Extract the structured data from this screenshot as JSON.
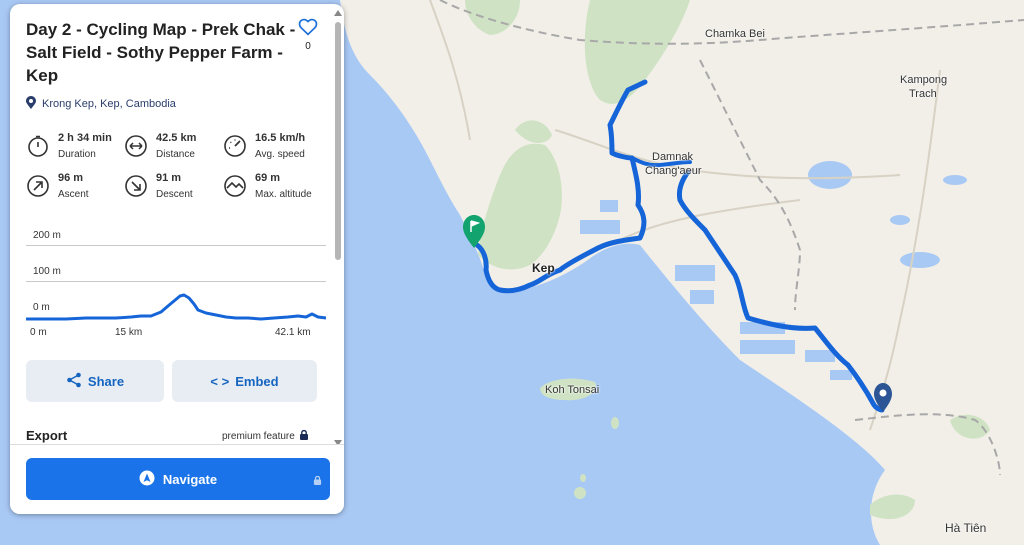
{
  "route": {
    "title": "Day 2 - Cycling Map - Prek Chak - Salt Field - Sothy Pepper Farm - Kep",
    "favorite_icon": "heart-outline-icon",
    "favorite_count": "0",
    "location": "Krong Kep, Kep, Cambodia",
    "location_icon": "location-pin-icon"
  },
  "stats": [
    {
      "icon": "stopwatch-icon",
      "value": "2 h 34 min",
      "label": "Duration"
    },
    {
      "icon": "distance-arrows-icon",
      "value": "42.5 km",
      "label": "Distance"
    },
    {
      "icon": "speedometer-icon",
      "value": "16.5 km/h",
      "label": "Avg. speed"
    },
    {
      "icon": "ascent-arrow-icon",
      "value": "96 m",
      "label": "Ascent"
    },
    {
      "icon": "descent-arrow-icon",
      "value": "91 m",
      "label": "Descent"
    },
    {
      "icon": "mountain-icon",
      "value": "69 m",
      "label": "Max. altitude"
    }
  ],
  "elevation_profile": {
    "y_ticks": [
      "200 m",
      "100 m",
      "0 m"
    ],
    "x_ticks": [
      "0 m",
      "15 km",
      "42.1 km"
    ]
  },
  "actions": {
    "share_label": "Share",
    "embed_label": "Embed",
    "embed_icon": "< >"
  },
  "export": {
    "label": "Export",
    "premium_label": "premium feature"
  },
  "navigate": {
    "label": "Navigate"
  },
  "map": {
    "labels": {
      "chamka_bei": "Chamka Bei",
      "kampong_trach_1": "Kampong",
      "kampong_trach_2": "Trach",
      "damnak_1": "Damnak",
      "damnak_2": "Chang'aeur",
      "kep": "Kep",
      "koh_tonsai": "Koh Tonsai",
      "ha_tien": "Hà Tiên"
    },
    "colors": {
      "water": "#a9c9f5",
      "land": "#f2efe9",
      "forest": "#cfe3c4",
      "route": "#1565d8",
      "start_marker": "#12a36e",
      "end_marker": "#2b5595"
    }
  }
}
